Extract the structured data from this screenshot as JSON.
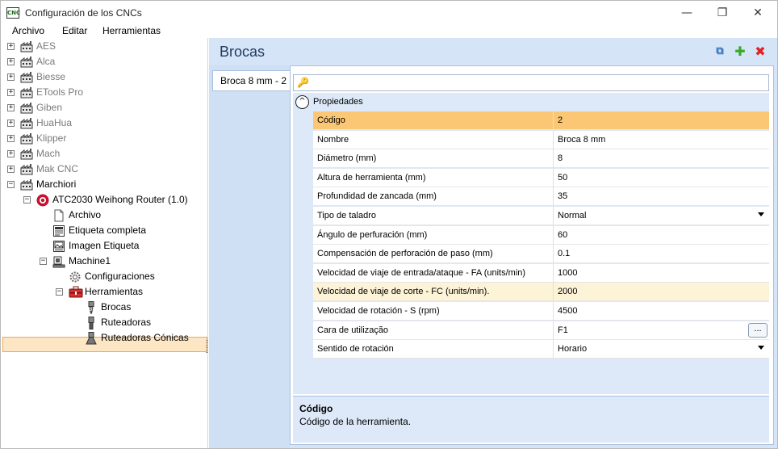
{
  "window": {
    "title": "Configuración de los CNCs",
    "app_icon_text": "CNC",
    "min_glyph": "—",
    "max_glyph": "❐",
    "close_glyph": "✕"
  },
  "menu": [
    "Archivo",
    "Editar",
    "Herramientas"
  ],
  "tree": {
    "manufacturers": [
      "AES",
      "Alca",
      "Biesse",
      "ETools Pro",
      "Giben",
      "HuaHua",
      "Klipper",
      "Mach",
      "Mak CNC"
    ],
    "expanded_manufacturer": "Marchiori",
    "machine": "ATC2030 Weihong Router (1.0)",
    "machine_children": [
      "Archivo",
      "Etiqueta completa",
      "Imagen Etiqueta"
    ],
    "machine1": "Machine1",
    "configuraciones": "Configuraciones",
    "herramientas": "Herramientas",
    "tool_types": [
      "Brocas",
      "Ruteadoras",
      "Ruteadoras Cónicas"
    ]
  },
  "panel": {
    "title": "Brocas",
    "tab": "Broca 8 mm - 2",
    "search_placeholder": "",
    "category": "Propiedades",
    "properties": [
      {
        "name": "Código",
        "value": "2"
      },
      {
        "name": "Nombre",
        "value": "Broca 8 mm"
      },
      {
        "name": "Diámetro (mm)",
        "value": "8"
      },
      {
        "name": "Altura de herramienta (mm)",
        "value": "50"
      },
      {
        "name": "Profundidad de zancada (mm)",
        "value": "35"
      },
      {
        "name": "Tipo de taladro",
        "value": "Normal"
      },
      {
        "name": "Ángulo de perfuración (mm)",
        "value": "60"
      },
      {
        "name": "Compensación de perforación de paso (mm)",
        "value": "0.1"
      },
      {
        "name": "Velocidad de viaje de entrada/ataque - FA (units/min)",
        "value": "1000"
      },
      {
        "name": "Velocidad de viaje de corte - FC (units/min).",
        "value": "2000"
      },
      {
        "name": "Velocidad de rotación - S (rpm)",
        "value": "4500"
      },
      {
        "name": "Cara de utilização",
        "value": "F1"
      },
      {
        "name": "Sentido de rotación",
        "value": "Horario"
      }
    ],
    "ellipsis_label": "...",
    "description_title": "Código",
    "description_text": "Código de la herramienta."
  },
  "colors": {
    "accent_blue": "#d5e4f7",
    "selected_row": "#fbc774",
    "tree_selection": "#fde6c4",
    "add_green": "#3aa829",
    "delete_red": "#e02020"
  },
  "icons": {
    "expand": "+",
    "collapse": "−",
    "category_collapse": "^",
    "search": "🔑",
    "copy": "⧉",
    "add": "✚",
    "delete": "✖"
  }
}
